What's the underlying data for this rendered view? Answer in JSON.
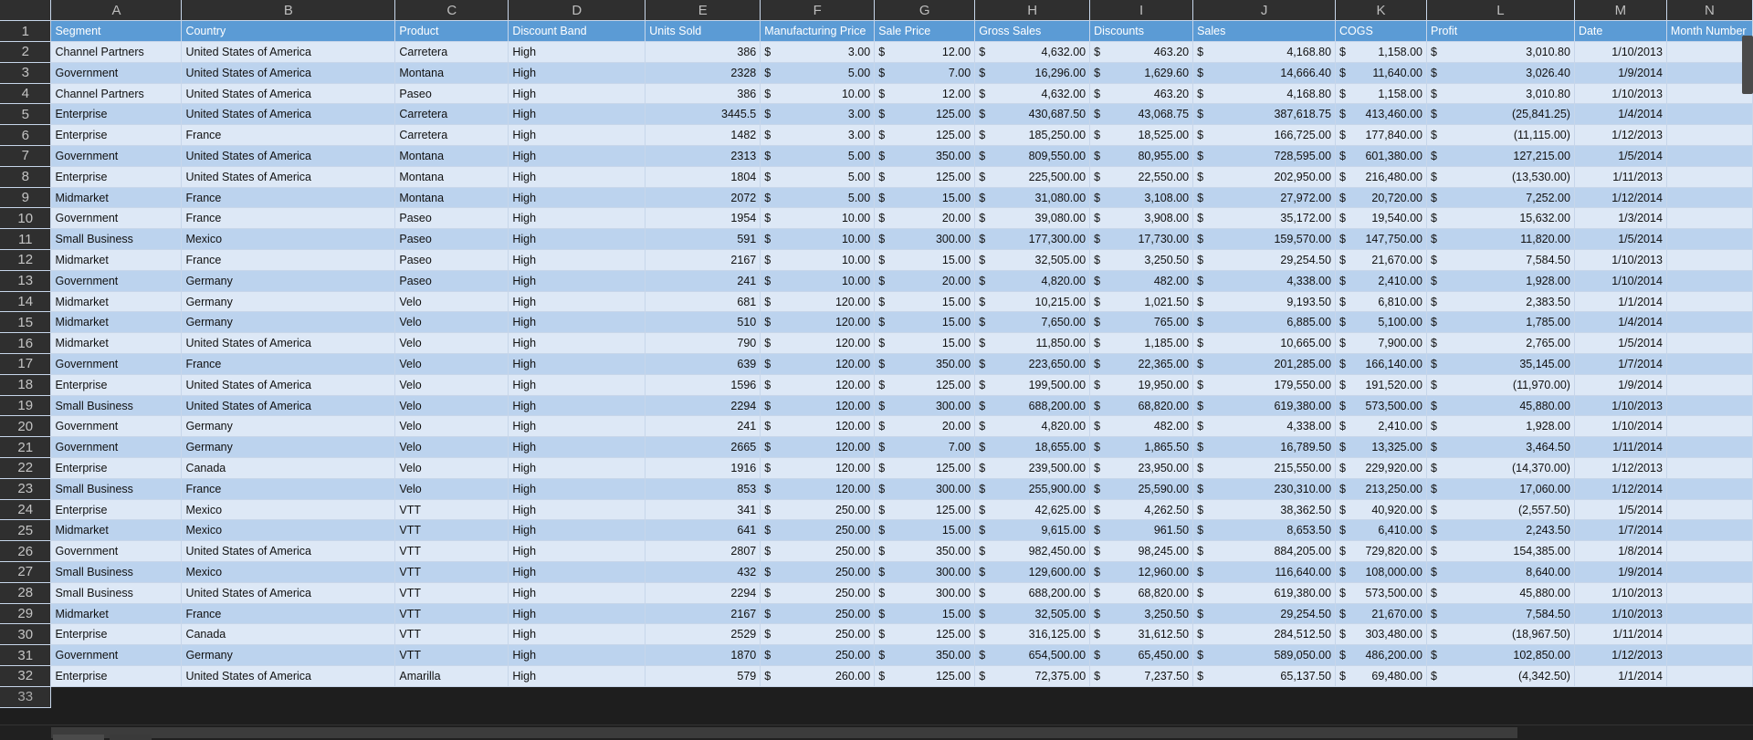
{
  "columns": [
    "A",
    "B",
    "C",
    "D",
    "E",
    "F",
    "G",
    "H",
    "I",
    "J",
    "K",
    "L",
    "M",
    "N"
  ],
  "header_row_number": "1",
  "headers": [
    "Segment",
    "Country",
    "Product",
    "Discount Band",
    "Units Sold",
    "Manufacturing Price",
    "Sale Price",
    "Gross Sales",
    "Discounts",
    "Sales",
    "COGS",
    "Profit",
    "Date",
    "Month Number"
  ],
  "currency_symbol": "$",
  "rows": [
    {
      "n": "2",
      "seg": "Channel Partners",
      "country": "United States of America",
      "product": "Carretera",
      "band": "High",
      "units": "386",
      "mfg": "3.00",
      "price": "12.00",
      "gross": "4,632.00",
      "disc": "463.20",
      "sales": "4,168.80",
      "cogs": "1,158.00",
      "profit": "3,010.80",
      "date": "1/10/2013"
    },
    {
      "n": "3",
      "seg": "Government",
      "country": "United States of America",
      "product": "Montana",
      "band": "High",
      "units": "2328",
      "mfg": "5.00",
      "price": "7.00",
      "gross": "16,296.00",
      "disc": "1,629.60",
      "sales": "14,666.40",
      "cogs": "11,640.00",
      "profit": "3,026.40",
      "date": "1/9/2014"
    },
    {
      "n": "4",
      "seg": "Channel Partners",
      "country": "United States of America",
      "product": "Paseo",
      "band": "High",
      "units": "386",
      "mfg": "10.00",
      "price": "12.00",
      "gross": "4,632.00",
      "disc": "463.20",
      "sales": "4,168.80",
      "cogs": "1,158.00",
      "profit": "3,010.80",
      "date": "1/10/2013"
    },
    {
      "n": "5",
      "seg": "Enterprise",
      "country": "United States of America",
      "product": "Carretera",
      "band": "High",
      "units": "3445.5",
      "mfg": "3.00",
      "price": "125.00",
      "gross": "430,687.50",
      "disc": "43,068.75",
      "sales": "387,618.75",
      "cogs": "413,460.00",
      "profit": "(25,841.25)",
      "date": "1/4/2014"
    },
    {
      "n": "6",
      "seg": "Enterprise",
      "country": "France",
      "product": "Carretera",
      "band": "High",
      "units": "1482",
      "mfg": "3.00",
      "price": "125.00",
      "gross": "185,250.00",
      "disc": "18,525.00",
      "sales": "166,725.00",
      "cogs": "177,840.00",
      "profit": "(11,115.00)",
      "date": "1/12/2013"
    },
    {
      "n": "7",
      "seg": "Government",
      "country": "United States of America",
      "product": "Montana",
      "band": "High",
      "units": "2313",
      "mfg": "5.00",
      "price": "350.00",
      "gross": "809,550.00",
      "disc": "80,955.00",
      "sales": "728,595.00",
      "cogs": "601,380.00",
      "profit": "127,215.00",
      "date": "1/5/2014"
    },
    {
      "n": "8",
      "seg": "Enterprise",
      "country": "United States of America",
      "product": "Montana",
      "band": "High",
      "units": "1804",
      "mfg": "5.00",
      "price": "125.00",
      "gross": "225,500.00",
      "disc": "22,550.00",
      "sales": "202,950.00",
      "cogs": "216,480.00",
      "profit": "(13,530.00)",
      "date": "1/11/2013"
    },
    {
      "n": "9",
      "seg": "Midmarket",
      "country": "France",
      "product": "Montana",
      "band": "High",
      "units": "2072",
      "mfg": "5.00",
      "price": "15.00",
      "gross": "31,080.00",
      "disc": "3,108.00",
      "sales": "27,972.00",
      "cogs": "20,720.00",
      "profit": "7,252.00",
      "date": "1/12/2014"
    },
    {
      "n": "10",
      "seg": "Government",
      "country": "France",
      "product": "Paseo",
      "band": "High",
      "units": "1954",
      "mfg": "10.00",
      "price": "20.00",
      "gross": "39,080.00",
      "disc": "3,908.00",
      "sales": "35,172.00",
      "cogs": "19,540.00",
      "profit": "15,632.00",
      "date": "1/3/2014"
    },
    {
      "n": "11",
      "seg": "Small Business",
      "country": "Mexico",
      "product": "Paseo",
      "band": "High",
      "units": "591",
      "mfg": "10.00",
      "price": "300.00",
      "gross": "177,300.00",
      "disc": "17,730.00",
      "sales": "159,570.00",
      "cogs": "147,750.00",
      "profit": "11,820.00",
      "date": "1/5/2014"
    },
    {
      "n": "12",
      "seg": "Midmarket",
      "country": "France",
      "product": "Paseo",
      "band": "High",
      "units": "2167",
      "mfg": "10.00",
      "price": "15.00",
      "gross": "32,505.00",
      "disc": "3,250.50",
      "sales": "29,254.50",
      "cogs": "21,670.00",
      "profit": "7,584.50",
      "date": "1/10/2013"
    },
    {
      "n": "13",
      "seg": "Government",
      "country": "Germany",
      "product": "Paseo",
      "band": "High",
      "units": "241",
      "mfg": "10.00",
      "price": "20.00",
      "gross": "4,820.00",
      "disc": "482.00",
      "sales": "4,338.00",
      "cogs": "2,410.00",
      "profit": "1,928.00",
      "date": "1/10/2014"
    },
    {
      "n": "14",
      "seg": "Midmarket",
      "country": "Germany",
      "product": "Velo",
      "band": "High",
      "units": "681",
      "mfg": "120.00",
      "price": "15.00",
      "gross": "10,215.00",
      "disc": "1,021.50",
      "sales": "9,193.50",
      "cogs": "6,810.00",
      "profit": "2,383.50",
      "date": "1/1/2014"
    },
    {
      "n": "15",
      "seg": "Midmarket",
      "country": "Germany",
      "product": "Velo",
      "band": "High",
      "units": "510",
      "mfg": "120.00",
      "price": "15.00",
      "gross": "7,650.00",
      "disc": "765.00",
      "sales": "6,885.00",
      "cogs": "5,100.00",
      "profit": "1,785.00",
      "date": "1/4/2014"
    },
    {
      "n": "16",
      "seg": "Midmarket",
      "country": "United States of America",
      "product": "Velo",
      "band": "High",
      "units": "790",
      "mfg": "120.00",
      "price": "15.00",
      "gross": "11,850.00",
      "disc": "1,185.00",
      "sales": "10,665.00",
      "cogs": "7,900.00",
      "profit": "2,765.00",
      "date": "1/5/2014"
    },
    {
      "n": "17",
      "seg": "Government",
      "country": "France",
      "product": "Velo",
      "band": "High",
      "units": "639",
      "mfg": "120.00",
      "price": "350.00",
      "gross": "223,650.00",
      "disc": "22,365.00",
      "sales": "201,285.00",
      "cogs": "166,140.00",
      "profit": "35,145.00",
      "date": "1/7/2014"
    },
    {
      "n": "18",
      "seg": "Enterprise",
      "country": "United States of America",
      "product": "Velo",
      "band": "High",
      "units": "1596",
      "mfg": "120.00",
      "price": "125.00",
      "gross": "199,500.00",
      "disc": "19,950.00",
      "sales": "179,550.00",
      "cogs": "191,520.00",
      "profit": "(11,970.00)",
      "date": "1/9/2014"
    },
    {
      "n": "19",
      "seg": "Small Business",
      "country": "United States of America",
      "product": "Velo",
      "band": "High",
      "units": "2294",
      "mfg": "120.00",
      "price": "300.00",
      "gross": "688,200.00",
      "disc": "68,820.00",
      "sales": "619,380.00",
      "cogs": "573,500.00",
      "profit": "45,880.00",
      "date": "1/10/2013"
    },
    {
      "n": "20",
      "seg": "Government",
      "country": "Germany",
      "product": "Velo",
      "band": "High",
      "units": "241",
      "mfg": "120.00",
      "price": "20.00",
      "gross": "4,820.00",
      "disc": "482.00",
      "sales": "4,338.00",
      "cogs": "2,410.00",
      "profit": "1,928.00",
      "date": "1/10/2014"
    },
    {
      "n": "21",
      "seg": "Government",
      "country": "Germany",
      "product": "Velo",
      "band": "High",
      "units": "2665",
      "mfg": "120.00",
      "price": "7.00",
      "gross": "18,655.00",
      "disc": "1,865.50",
      "sales": "16,789.50",
      "cogs": "13,325.00",
      "profit": "3,464.50",
      "date": "1/11/2014"
    },
    {
      "n": "22",
      "seg": "Enterprise",
      "country": "Canada",
      "product": "Velo",
      "band": "High",
      "units": "1916",
      "mfg": "120.00",
      "price": "125.00",
      "gross": "239,500.00",
      "disc": "23,950.00",
      "sales": "215,550.00",
      "cogs": "229,920.00",
      "profit": "(14,370.00)",
      "date": "1/12/2013"
    },
    {
      "n": "23",
      "seg": "Small Business",
      "country": "France",
      "product": "Velo",
      "band": "High",
      "units": "853",
      "mfg": "120.00",
      "price": "300.00",
      "gross": "255,900.00",
      "disc": "25,590.00",
      "sales": "230,310.00",
      "cogs": "213,250.00",
      "profit": "17,060.00",
      "date": "1/12/2014"
    },
    {
      "n": "24",
      "seg": "Enterprise",
      "country": "Mexico",
      "product": "VTT",
      "band": "High",
      "units": "341",
      "mfg": "250.00",
      "price": "125.00",
      "gross": "42,625.00",
      "disc": "4,262.50",
      "sales": "38,362.50",
      "cogs": "40,920.00",
      "profit": "(2,557.50)",
      "date": "1/5/2014"
    },
    {
      "n": "25",
      "seg": "Midmarket",
      "country": "Mexico",
      "product": "VTT",
      "band": "High",
      "units": "641",
      "mfg": "250.00",
      "price": "15.00",
      "gross": "9,615.00",
      "disc": "961.50",
      "sales": "8,653.50",
      "cogs": "6,410.00",
      "profit": "2,243.50",
      "date": "1/7/2014"
    },
    {
      "n": "26",
      "seg": "Government",
      "country": "United States of America",
      "product": "VTT",
      "band": "High",
      "units": "2807",
      "mfg": "250.00",
      "price": "350.00",
      "gross": "982,450.00",
      "disc": "98,245.00",
      "sales": "884,205.00",
      "cogs": "729,820.00",
      "profit": "154,385.00",
      "date": "1/8/2014"
    },
    {
      "n": "27",
      "seg": "Small Business",
      "country": "Mexico",
      "product": "VTT",
      "band": "High",
      "units": "432",
      "mfg": "250.00",
      "price": "300.00",
      "gross": "129,600.00",
      "disc": "12,960.00",
      "sales": "116,640.00",
      "cogs": "108,000.00",
      "profit": "8,640.00",
      "date": "1/9/2014"
    },
    {
      "n": "28",
      "seg": "Small Business",
      "country": "United States of America",
      "product": "VTT",
      "band": "High",
      "units": "2294",
      "mfg": "250.00",
      "price": "300.00",
      "gross": "688,200.00",
      "disc": "68,820.00",
      "sales": "619,380.00",
      "cogs": "573,500.00",
      "profit": "45,880.00",
      "date": "1/10/2013"
    },
    {
      "n": "29",
      "seg": "Midmarket",
      "country": "France",
      "product": "VTT",
      "band": "High",
      "units": "2167",
      "mfg": "250.00",
      "price": "15.00",
      "gross": "32,505.00",
      "disc": "3,250.50",
      "sales": "29,254.50",
      "cogs": "21,670.00",
      "profit": "7,584.50",
      "date": "1/10/2013"
    },
    {
      "n": "30",
      "seg": "Enterprise",
      "country": "Canada",
      "product": "VTT",
      "band": "High",
      "units": "2529",
      "mfg": "250.00",
      "price": "125.00",
      "gross": "316,125.00",
      "disc": "31,612.50",
      "sales": "284,512.50",
      "cogs": "303,480.00",
      "profit": "(18,967.50)",
      "date": "1/11/2014"
    },
    {
      "n": "31",
      "seg": "Government",
      "country": "Germany",
      "product": "VTT",
      "band": "High",
      "units": "1870",
      "mfg": "250.00",
      "price": "350.00",
      "gross": "654,500.00",
      "disc": "65,450.00",
      "sales": "589,050.00",
      "cogs": "486,200.00",
      "profit": "102,850.00",
      "date": "1/12/2013"
    },
    {
      "n": "32",
      "seg": "Enterprise",
      "country": "United States of America",
      "product": "Amarilla",
      "band": "High",
      "units": "579",
      "mfg": "260.00",
      "price": "125.00",
      "gross": "72,375.00",
      "disc": "7,237.50",
      "sales": "65,137.50",
      "cogs": "69,480.00",
      "profit": "(4,342.50)",
      "date": "1/1/2014"
    }
  ],
  "partial_row_number": "33"
}
